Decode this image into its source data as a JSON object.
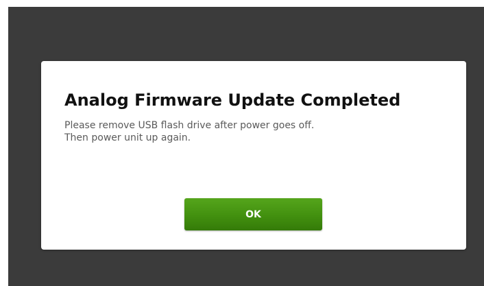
{
  "dialog": {
    "title": "Analog Firmware Update Completed",
    "message_lines": [
      "Please remove USB flash drive after power goes off.",
      "Then power unit up again."
    ],
    "ok_label": "OK"
  },
  "colors": {
    "backdrop": "#3b3b3b",
    "dialog_background": "#ffffff",
    "button_green": "#42900f",
    "title_text": "#111111",
    "message_text": "#5a5a5a"
  }
}
